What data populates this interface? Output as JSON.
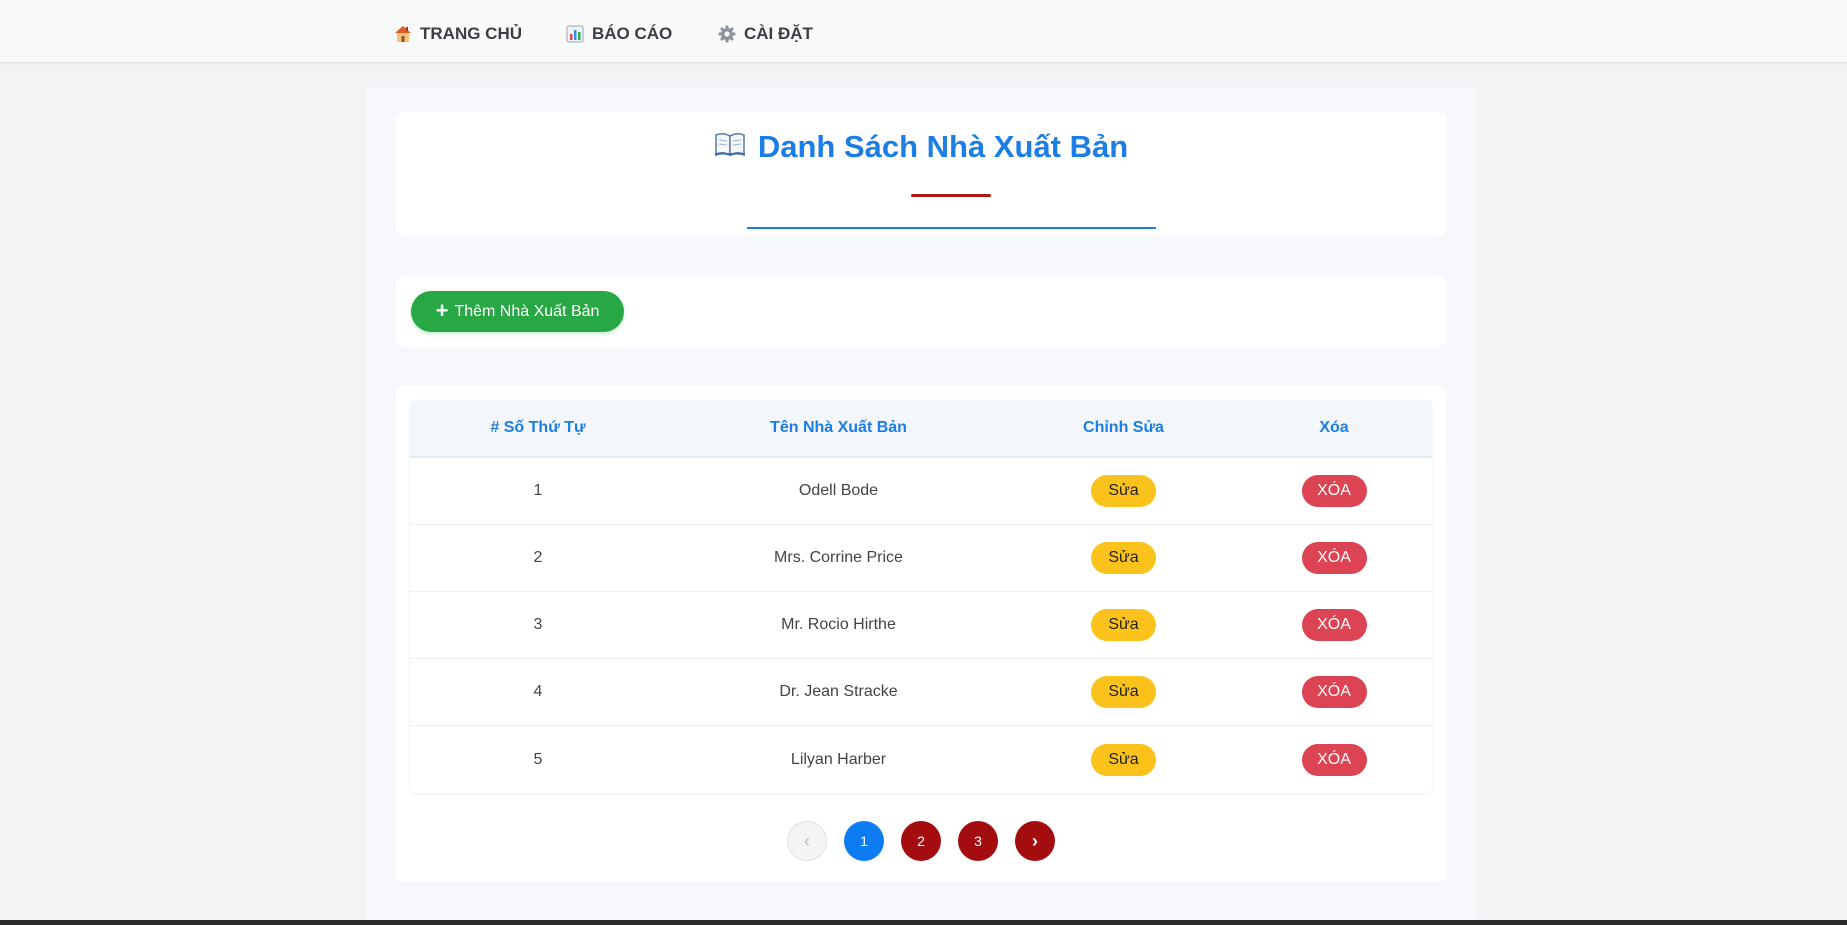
{
  "nav": {
    "items": [
      {
        "label": "TRANG CHỦ",
        "icon": "home-icon"
      },
      {
        "label": "BÁO CÁO",
        "icon": "bar-chart-icon"
      },
      {
        "label": "CÀI ĐẶT",
        "icon": "gear-icon"
      }
    ]
  },
  "header": {
    "title": "Danh Sách Nhà Xuất Bản",
    "title_icon": "open-book-icon"
  },
  "actions": {
    "add_label": "Thêm Nhà Xuất Bản"
  },
  "table": {
    "columns": [
      "# Số Thứ Tự",
      "Tên Nhà Xuất Bản",
      "Chỉnh Sửa",
      "Xóa"
    ],
    "edit_label": "Sửa",
    "delete_label": "XÓA",
    "rows": [
      {
        "index": "1",
        "name": "Odell Bode"
      },
      {
        "index": "2",
        "name": "Mrs. Corrine Price"
      },
      {
        "index": "3",
        "name": "Mr. Rocio Hirthe"
      },
      {
        "index": "4",
        "name": "Dr. Jean Stracke"
      },
      {
        "index": "5",
        "name": "Lilyan Harber"
      }
    ]
  },
  "pagination": {
    "prev": "‹",
    "pages": [
      "1",
      "2",
      "3"
    ],
    "current": "1",
    "next": "›"
  },
  "colors": {
    "accent": "#1a7ee6",
    "add": "#28a745",
    "edit": "#fbc21b",
    "delete": "#dc4454",
    "page": "#a30d10"
  }
}
